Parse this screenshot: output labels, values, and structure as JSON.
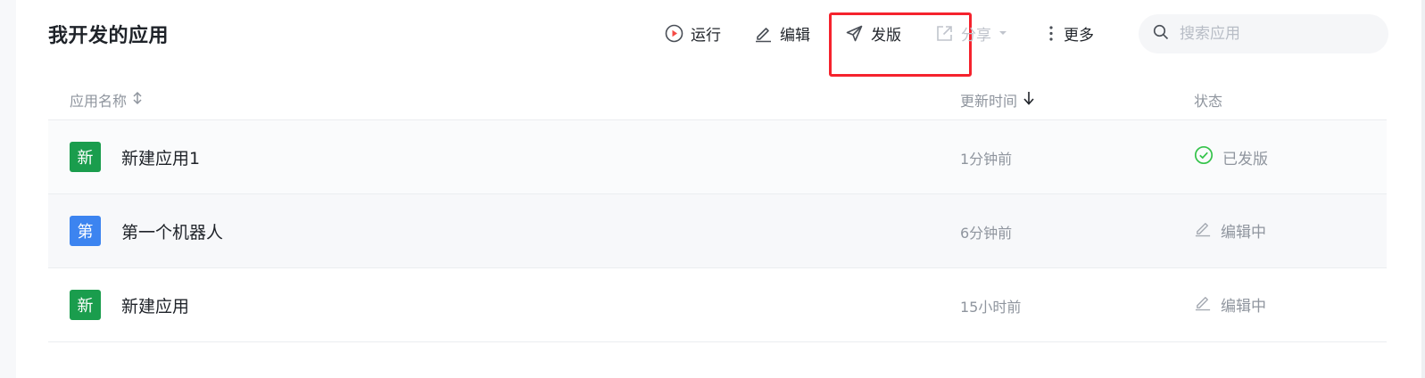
{
  "header": {
    "title": "我开发的应用",
    "toolbar": {
      "run_label": "运行",
      "edit_label": "编辑",
      "publish_label": "发版",
      "share_label": "分享",
      "more_label": "更多"
    },
    "search": {
      "placeholder": "搜索应用",
      "value": ""
    }
  },
  "table": {
    "columns": {
      "name": "应用名称",
      "updated": "更新时间",
      "status": "状态"
    },
    "rows": [
      {
        "avatar": "新",
        "avatar_color": "#1a9d4d",
        "name": "新建应用1",
        "updated": "1分钟前",
        "status": "已发版",
        "status_icon": "check-circle-icon"
      },
      {
        "avatar": "第",
        "avatar_color": "#3c84f0",
        "name": "第一个机器人",
        "updated": "6分钟前",
        "status": "编辑中",
        "status_icon": "pencil-icon"
      },
      {
        "avatar": "新",
        "avatar_color": "#1a9d4d",
        "name": "新建应用",
        "updated": "15小时前",
        "status": "编辑中",
        "status_icon": "pencil-icon"
      }
    ]
  },
  "colors": {
    "highlight": "#f5222d",
    "success": "#34c34a",
    "run_icon": "#f54a45"
  }
}
